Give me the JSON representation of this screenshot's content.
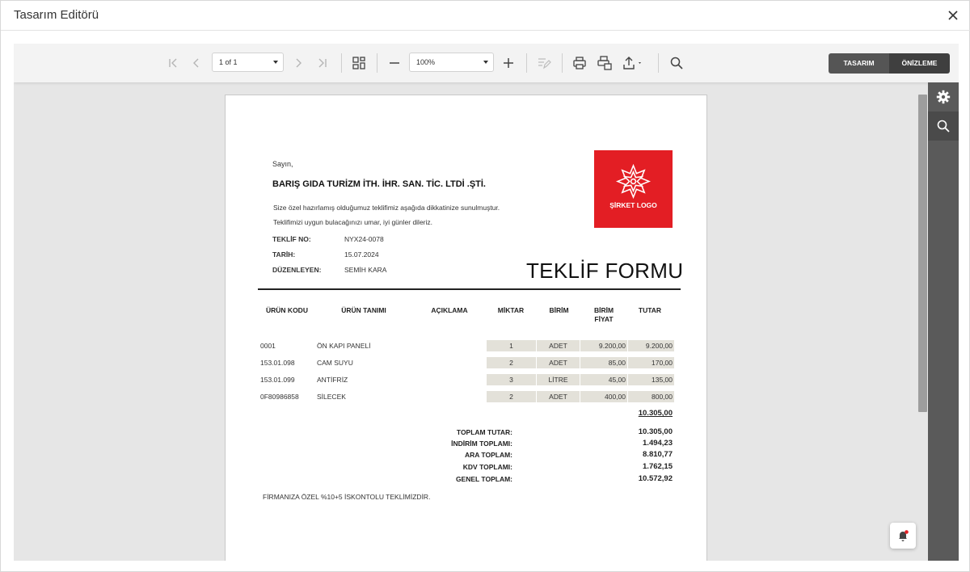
{
  "window": {
    "title": "Tasarım Editörü"
  },
  "toolbar": {
    "page_select": "1 of 1",
    "zoom_select": "100%",
    "mode_design": "TASARIM",
    "mode_preview": "ÖNİZLEME"
  },
  "document": {
    "greeting": "Sayın,",
    "company": "BARIŞ GIDA TURİZM İTH. İHR. SAN. TİC. LTDİ .ŞTİ.",
    "intro_line1": "Size özel hazırlamış olduğumuz teklifimiz aşağıda dikkatinize sunulmuştur.",
    "intro_line2": "Teklifimizi uygun bulacağınızı umar, iyi günler dileriz.",
    "meta": [
      {
        "label": "TEKLİF NO:",
        "value": "NYX24-0078"
      },
      {
        "label": "TARİH:",
        "value": "15.07.2024"
      },
      {
        "label": "DÜZENLEYEN:",
        "value": "SEMİH KARA"
      }
    ],
    "logo_text": "ŞİRKET LOGO",
    "form_title": "TEKLİF FORMU",
    "columns": {
      "code": "ÜRÜN KODU",
      "name": "ÜRÜN TANIMI",
      "desc": "AÇIKLAMA",
      "qty": "MİKTAR",
      "unit": "BİRİM",
      "price_line1": "BİRİM",
      "price_line2": "FİYAT",
      "total": "TUTAR"
    },
    "rows": [
      {
        "code": "0001",
        "name": "ÖN KAPI PANELİ",
        "qty": "1",
        "unit": "ADET",
        "price": "9.200,00",
        "total": "9.200,00"
      },
      {
        "code": "153.01.098",
        "name": "CAM SUYU",
        "qty": "2",
        "unit": "ADET",
        "price": "85,00",
        "total": "170,00"
      },
      {
        "code": "153.01.099",
        "name": "ANTİFRİZ",
        "qty": "3",
        "unit": "LİTRE",
        "price": "45,00",
        "total": "135,00"
      },
      {
        "code": "0F80986858",
        "name": "SİLECEK",
        "qty": "2",
        "unit": "ADET",
        "price": "400,00",
        "total": "800,00"
      }
    ],
    "subtotal": "10.305,00",
    "totals": [
      {
        "label": "TOPLAM TUTAR:",
        "value": "10.305,00"
      },
      {
        "label": "İNDİRİM TOPLAMI:",
        "value": "1.494,23"
      },
      {
        "label": "ARA TOPLAM:",
        "value": "8.810,77"
      },
      {
        "label": "KDV TOPLAMI:",
        "value": "1.762,15"
      },
      {
        "label": "GENEL TOPLAM:",
        "value": "10.572,92"
      }
    ],
    "footer_note": "FİRMANIZA ÖZEL %10+5 İSKONTOLU TEKLİMİZDİR."
  },
  "icons": {
    "close": "close-icon",
    "first": "first-page-icon",
    "prev": "previous-page-icon",
    "next": "next-page-icon",
    "last": "last-page-icon",
    "multipage": "multipage-icon",
    "zoom_out": "zoom-out-icon",
    "zoom_in": "zoom-in-icon",
    "highlight": "highlight-editing-icon",
    "print": "print-icon",
    "print_page": "print-page-icon",
    "export": "export-icon",
    "search": "search-icon",
    "settings": "gear-icon",
    "bell": "notification-bell-icon"
  },
  "colors": {
    "logo_red": "#e31e24",
    "cell_fill": "#e3e1d9",
    "toolbar_bg": "#f3f3f3",
    "side_panel": "#5a5a5a"
  }
}
